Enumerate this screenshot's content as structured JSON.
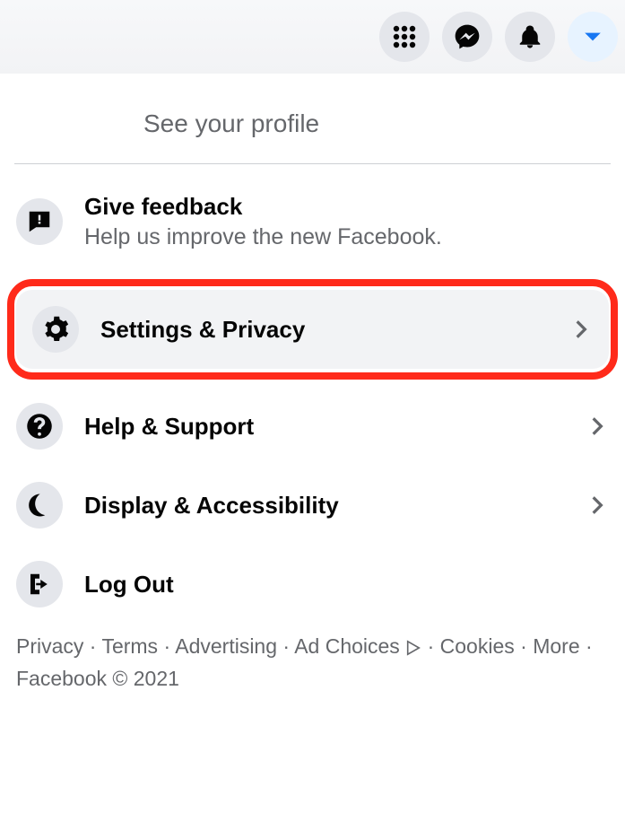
{
  "profile": {
    "see_profile": "See your profile"
  },
  "feedback": {
    "title": "Give feedback",
    "subtitle": "Help us improve the new Facebook."
  },
  "menu": {
    "settings": "Settings & Privacy",
    "help": "Help & Support",
    "display": "Display & Accessibility",
    "logout": "Log Out"
  },
  "footer": {
    "privacy": "Privacy",
    "terms": "Terms",
    "advertising": "Advertising",
    "adchoices": "Ad Choices",
    "cookies": "Cookies",
    "more": "More",
    "copyright": "Facebook © 2021"
  }
}
